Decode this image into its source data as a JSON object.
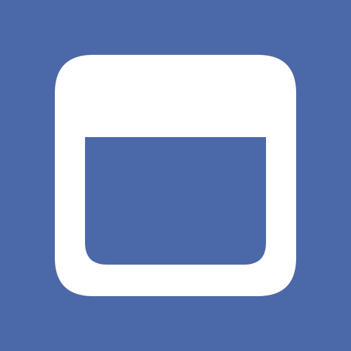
{
  "app": {
    "icon": "browser-window-icon",
    "colors": {
      "background": "#4b69a8",
      "foreground": "#ffffff"
    }
  }
}
